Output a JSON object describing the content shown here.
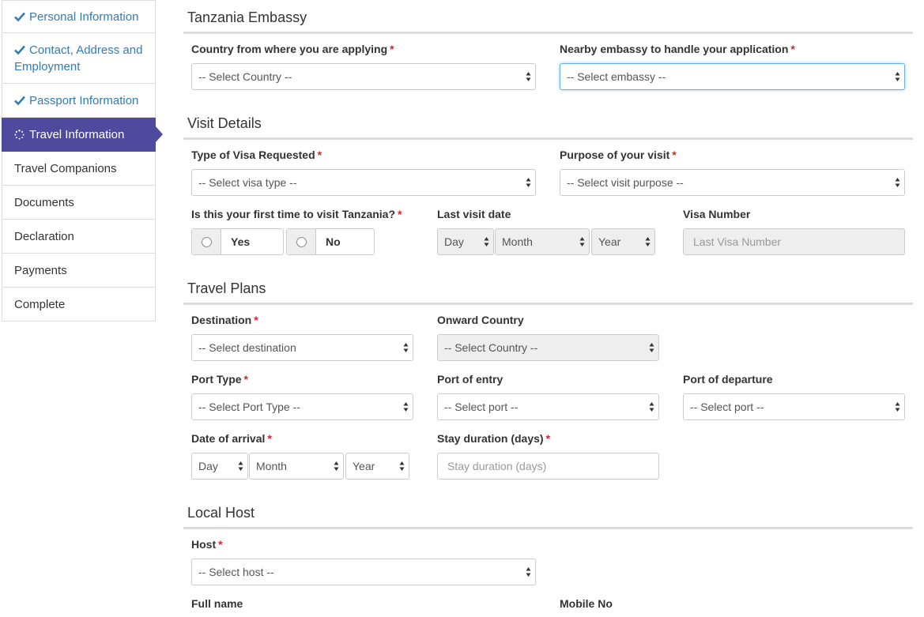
{
  "sidebar": {
    "items": [
      {
        "label": "Personal Information",
        "state": "done"
      },
      {
        "label": "Contact, Address and Employment",
        "state": "done"
      },
      {
        "label": "Passport Information",
        "state": "done"
      },
      {
        "label": "Travel Information",
        "state": "active"
      },
      {
        "label": "Travel Companions",
        "state": "pending"
      },
      {
        "label": "Documents",
        "state": "pending"
      },
      {
        "label": "Declaration",
        "state": "pending"
      },
      {
        "label": "Payments",
        "state": "pending"
      },
      {
        "label": "Complete",
        "state": "pending"
      }
    ]
  },
  "embassy": {
    "title": "Tanzania Embassy",
    "country_label": "Country from where you are applying",
    "country_value": "-- Select Country --",
    "embassy_label": "Nearby embassy to handle your application",
    "embassy_value": "-- Select embassy --"
  },
  "visit": {
    "title": "Visit Details",
    "visa_type_label": "Type of Visa Requested",
    "visa_type_value": "-- Select visa type --",
    "purpose_label": "Purpose of your visit",
    "purpose_value": "-- Select visit purpose --",
    "first_time_label": "Is this your first time to visit Tanzania?",
    "yes_label": "Yes",
    "no_label": "No",
    "last_visit_label": "Last visit date",
    "day": "Day",
    "month": "Month",
    "year": "Year",
    "visa_number_label": "Visa Number",
    "visa_number_placeholder": "Last Visa Number"
  },
  "plans": {
    "title": "Travel Plans",
    "destination_label": "Destination",
    "destination_value": "-- Select destination",
    "onward_label": "Onward Country",
    "onward_value": "-- Select Country --",
    "port_type_label": "Port Type",
    "port_type_value": "-- Select Port Type --",
    "port_entry_label": "Port of entry",
    "port_entry_value": "-- Select port --",
    "port_departure_label": "Port of departure",
    "port_departure_value": "-- Select port --",
    "arrival_label": "Date of arrival",
    "day": "Day",
    "month": "Month",
    "year": "Year",
    "stay_label": "Stay duration (days)",
    "stay_placeholder": "Stay duration (days)"
  },
  "host": {
    "title": "Local Host",
    "host_label": "Host",
    "host_value": "-- Select host --",
    "full_name_label": "Full name",
    "mobile_label": "Mobile No"
  },
  "colors": {
    "active_nav": "#4f4a9e",
    "link": "#337ab7",
    "required": "#d9232d"
  },
  "icons": {
    "done": "checkmark-icon",
    "active": "spinner-icon",
    "select": "up-down-arrow-icon"
  }
}
